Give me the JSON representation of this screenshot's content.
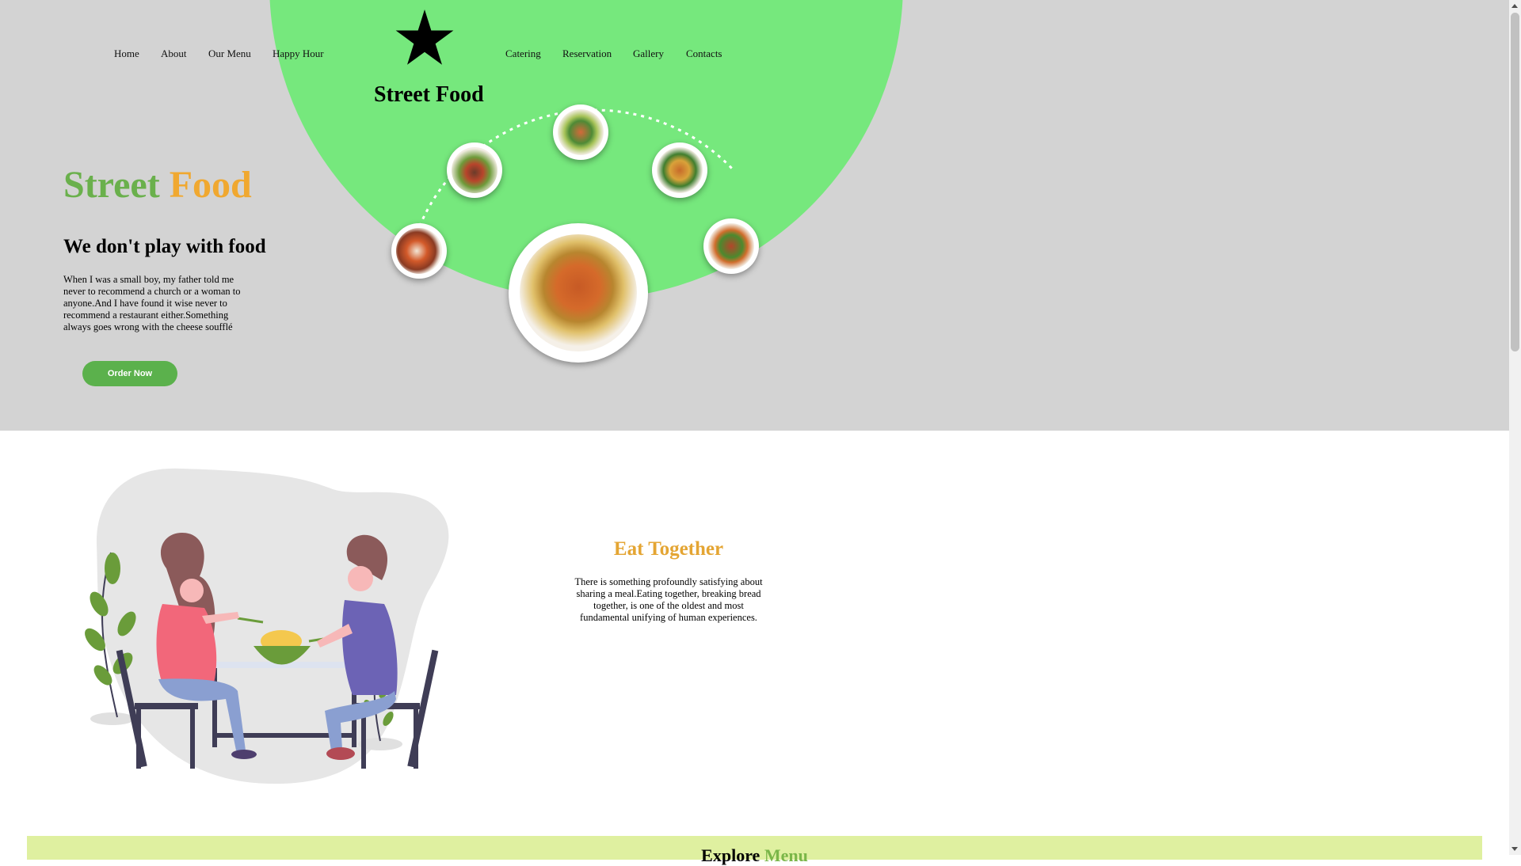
{
  "nav": {
    "left": [
      "Home",
      "About",
      "Our Menu",
      "Happy Hour"
    ],
    "right": [
      "Catering",
      "Reservation",
      "Gallery",
      "Contacts"
    ]
  },
  "brand": {
    "name": "Street Food",
    "logo_icon": "star-icon"
  },
  "hero": {
    "title_word1": "Street",
    "title_word2": "Food",
    "subtitle": "We don't play with food",
    "text": "When I was a small boy, my father told me never to recommend a church or a woman to anyone.And I have found it wise never to recommend a restaurant either.Something always goes wrong with the cheese soufflé",
    "order_button": "Order Now"
  },
  "eat_together": {
    "title": "Eat Together",
    "text": "There is something profoundly satisfying about sharing a meal.Eating together, breaking bread together, is one of the oldest and most fundamental unifying of human experiences."
  },
  "explore": {
    "word1": "Explore",
    "word2": "Menu"
  },
  "colors": {
    "hero_bg": "#d3d3d3",
    "accent_green": "#76e87d",
    "button_green": "#5bb14c",
    "title_green": "#6ab04c",
    "title_orange": "#f0a830",
    "eat_orange": "#e4a533",
    "band_bg": "#dff0a0"
  }
}
